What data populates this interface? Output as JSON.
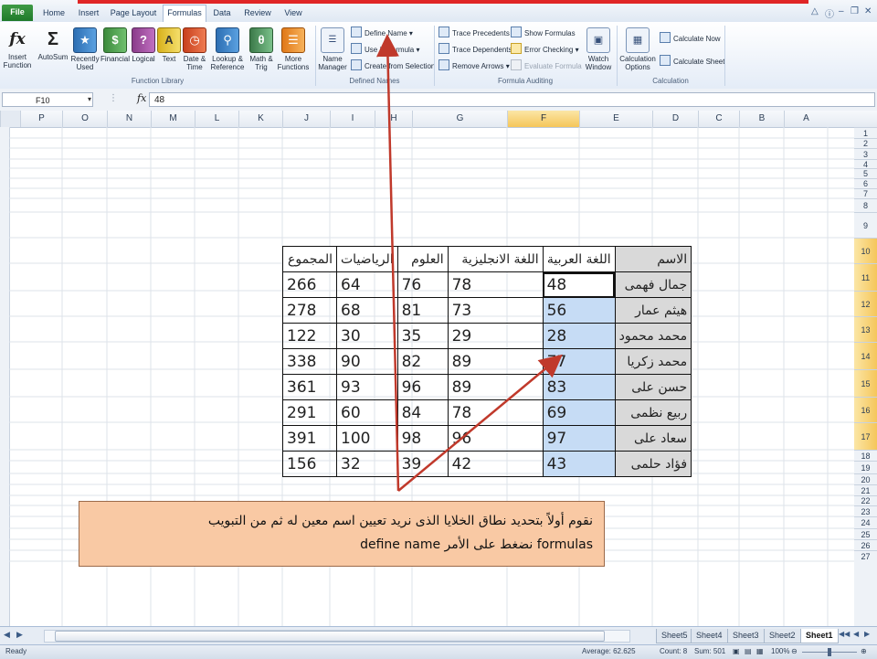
{
  "tabs": {
    "file": "File",
    "home": "Home",
    "insert": "Insert",
    "page_layout": "Page Layout",
    "formulas": "Formulas",
    "data": "Data",
    "review": "Review",
    "view": "View"
  },
  "ribbon": {
    "function_library": {
      "label": "Function Library",
      "insert_function": "Insert Function",
      "autosum": "AutoSum",
      "recently_used": "Recently Used",
      "financial": "Financial",
      "logical": "Logical",
      "text": "Text",
      "date_time": "Date & Time",
      "lookup_reference": "Lookup & Reference",
      "math_trig": "Math & Trig",
      "more_functions": "More Functions"
    },
    "defined_names": {
      "label": "Defined Names",
      "name_manager": "Name Manager",
      "define_name": "Define Name",
      "use_in_formula": "Use in Formula",
      "create_from_selection": "Create from Selection"
    },
    "formula_auditing": {
      "label": "Formula Auditing",
      "trace_precedents": "Trace Precedents",
      "trace_dependents": "Trace Dependents",
      "remove_arrows": "Remove Arrows",
      "show_formulas": "Show Formulas",
      "error_checking": "Error Checking",
      "evaluate_formula": "Evaluate Formula",
      "watch_window": "Watch Window"
    },
    "calculation": {
      "label": "Calculation",
      "calculation_options": "Calculation Options",
      "calculate_now": "Calculate Now",
      "calculate_sheet": "Calculate Sheet"
    }
  },
  "formula_bar": {
    "name_box": "F10",
    "fx": "fx",
    "value": "48"
  },
  "columns": [
    "P",
    "O",
    "N",
    "M",
    "L",
    "K",
    "J",
    "I",
    "H",
    "G",
    "F",
    "E",
    "D",
    "C",
    "B",
    "A"
  ],
  "selected_column": "F",
  "rows": [
    "1",
    "2",
    "3",
    "4",
    "5",
    "6",
    "7",
    "8",
    "9",
    "10",
    "11",
    "12",
    "13",
    "14",
    "15",
    "16",
    "17",
    "18",
    "19",
    "20",
    "21",
    "22",
    "23",
    "24",
    "25",
    "26",
    "27"
  ],
  "table": {
    "headers": [
      "الاسم",
      "اللغة العربية",
      "اللغة الانجليزية",
      "العلوم",
      "الرياضيات",
      "المجموع"
    ],
    "rows": [
      [
        "جمال فهمى",
        "48",
        "78",
        "76",
        "64",
        "266"
      ],
      [
        "هيثم عمار",
        "56",
        "73",
        "81",
        "68",
        "278"
      ],
      [
        "محمد محمود",
        "28",
        "29",
        "35",
        "30",
        "122"
      ],
      [
        "محمد زكريا",
        "77",
        "89",
        "82",
        "90",
        "338"
      ],
      [
        "حسن على",
        "83",
        "89",
        "96",
        "93",
        "361"
      ],
      [
        "ربيع نظمى",
        "69",
        "78",
        "84",
        "60",
        "291"
      ],
      [
        "سعاد على",
        "97",
        "96",
        "98",
        "100",
        "391"
      ],
      [
        "فؤاد حلمى",
        "43",
        "42",
        "39",
        "32",
        "156"
      ]
    ]
  },
  "callout": {
    "line1": "نقوم أولاً بتحديد نطاق الخلايا الذى نريد تعيين اسم معين له ثم من التبويب",
    "line2": "formulas نضغط على الأمر define name"
  },
  "sheets": [
    "Sheet5",
    "Sheet4",
    "Sheet3",
    "Sheet2",
    "Sheet1"
  ],
  "active_sheet": "Sheet1",
  "status": {
    "ready": "Ready",
    "average": "Average: 62.625",
    "count": "Count: 8",
    "sum": "Sum: 501",
    "zoom": "100%"
  },
  "colors": {
    "selection": "#c6dcf5",
    "callout": "#f9c9a4",
    "arrow": "#c0392b",
    "file_tab": "#2e8b3a"
  }
}
